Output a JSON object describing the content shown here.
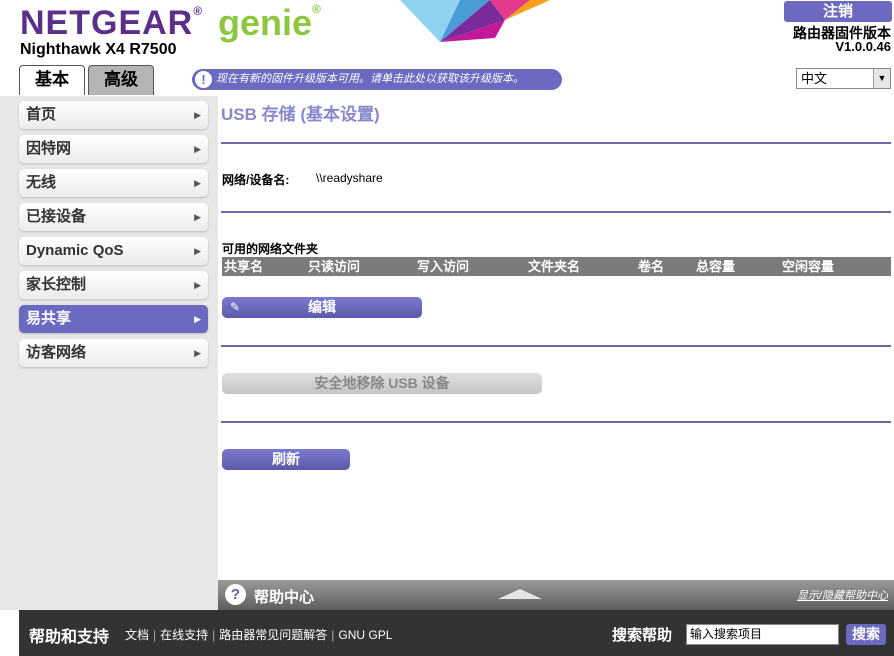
{
  "header": {
    "brand": "NETGEAR",
    "brand_reg": "®",
    "genie": "genie",
    "genie_reg": "®",
    "model": "Nighthawk X4 R7500",
    "register_button": "注销",
    "firmware_label": "路由器固件版本",
    "firmware_version": "V1.0.0.46",
    "tabs": [
      {
        "label": "基本",
        "active": true
      },
      {
        "label": "高级",
        "active": false
      }
    ],
    "notice_icon": "!",
    "notice": "现在有新的固件升级版本可用。请单击此处以获取该升级版本。",
    "language": "中文",
    "language_arrow": "▼"
  },
  "sidebar": {
    "items": [
      {
        "label": "首页",
        "active": false
      },
      {
        "label": "因特网",
        "active": false
      },
      {
        "label": "无线",
        "active": false
      },
      {
        "label": "已接设备",
        "active": false
      },
      {
        "label": "Dynamic QoS",
        "active": false
      },
      {
        "label": "家长控制",
        "active": false
      },
      {
        "label": "易共享",
        "active": true
      },
      {
        "label": "访客网络",
        "active": false
      }
    ],
    "arrow_glyph": "▶"
  },
  "main": {
    "title": "USB 存储 (基本设置)",
    "device_name_label": "网络/设备名:",
    "device_name_value": "\\\\readyshare",
    "folders_title": "可用的网络文件夹",
    "table_headers": [
      "共享名",
      "只读访问",
      "写入访问",
      "文件夹名",
      "卷名",
      "总容量",
      "空闲容量"
    ],
    "edit_button": "编辑",
    "edit_icon": "✎",
    "remove_button": "安全地移除 USB 设备",
    "refresh_button": "刷新"
  },
  "helpbar": {
    "icon": "?",
    "title": "帮助中心",
    "toggle": "显示/隐藏帮助中心"
  },
  "footer": {
    "title": "帮助和支持",
    "links": [
      "文档",
      "在线支持",
      "路由器常见问题解答",
      "GNU GPL"
    ],
    "search_label": "搜索帮助",
    "search_value": "输入搜索项目",
    "search_button": "搜索"
  }
}
